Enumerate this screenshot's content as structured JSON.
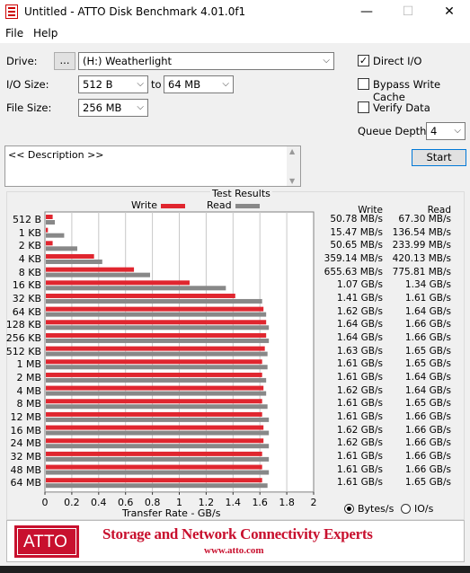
{
  "window": {
    "title": "Untitled - ATTO Disk Benchmark 4.01.0f1",
    "minimize": "—",
    "maximize": "☐",
    "close": "✕"
  },
  "menu": [
    "File",
    "Help"
  ],
  "form": {
    "drive_label": "Drive:",
    "browse_label": "...",
    "drive_value": "(H:) Weatherlight",
    "io_size_label": "I/O Size:",
    "io_from": "512 B",
    "to_label": "to",
    "io_to": "64 MB",
    "file_size_label": "File Size:",
    "file_size": "256 MB",
    "direct_io": "Direct I/O",
    "bypass_write_cache": "Bypass Write Cache",
    "verify_data": "Verify Data",
    "queue_depth_label": "Queue Depth:",
    "queue_depth": "4",
    "start_label": "Start",
    "description": "<< Description >>"
  },
  "results": {
    "title": "Test Results",
    "write_header": "Write",
    "read_header": "Read",
    "units": {
      "bytes": "Bytes/s",
      "io": "IO/s"
    }
  },
  "chart_data": {
    "type": "bar",
    "orientation": "horizontal",
    "title": "Test Results",
    "xlabel": "Transfer Rate - GB/s",
    "xlim": [
      0,
      2
    ],
    "xticks": [
      "0",
      "0.2",
      "0.4",
      "0.6",
      "0.8",
      "1",
      "1.2",
      "1.4",
      "1.6",
      "1.8",
      "2"
    ],
    "categories": [
      "512 B",
      "1 KB",
      "2 KB",
      "4 KB",
      "8 KB",
      "16 KB",
      "32 KB",
      "64 KB",
      "128 KB",
      "256 KB",
      "512 KB",
      "1 MB",
      "2 MB",
      "4 MB",
      "8 MB",
      "12 MB",
      "16 MB",
      "24 MB",
      "32 MB",
      "48 MB",
      "64 MB"
    ],
    "series": [
      {
        "name": "Write",
        "color": "#e0262f",
        "values": [
          0.0508,
          0.0155,
          0.0507,
          0.359,
          0.656,
          1.07,
          1.41,
          1.62,
          1.64,
          1.64,
          1.63,
          1.61,
          1.61,
          1.62,
          1.61,
          1.61,
          1.62,
          1.62,
          1.61,
          1.61,
          1.61
        ]
      },
      {
        "name": "Read",
        "color": "#888888",
        "values": [
          0.0673,
          0.1365,
          0.234,
          0.42,
          0.776,
          1.34,
          1.61,
          1.64,
          1.66,
          1.66,
          1.65,
          1.65,
          1.64,
          1.64,
          1.65,
          1.66,
          1.66,
          1.66,
          1.66,
          1.66,
          1.65
        ]
      }
    ],
    "write_text": [
      "50.78 MB/s",
      "15.47 MB/s",
      "50.65 MB/s",
      "359.14 MB/s",
      "655.63 MB/s",
      "1.07 GB/s",
      "1.41 GB/s",
      "1.62 GB/s",
      "1.64 GB/s",
      "1.64 GB/s",
      "1.63 GB/s",
      "1.61 GB/s",
      "1.61 GB/s",
      "1.62 GB/s",
      "1.61 GB/s",
      "1.61 GB/s",
      "1.62 GB/s",
      "1.62 GB/s",
      "1.61 GB/s",
      "1.61 GB/s",
      "1.61 GB/s"
    ],
    "read_text": [
      "67.30 MB/s",
      "136.54 MB/s",
      "233.99 MB/s",
      "420.13 MB/s",
      "775.81 MB/s",
      "1.34 GB/s",
      "1.61 GB/s",
      "1.64 GB/s",
      "1.66 GB/s",
      "1.66 GB/s",
      "1.65 GB/s",
      "1.65 GB/s",
      "1.64 GB/s",
      "1.64 GB/s",
      "1.65 GB/s",
      "1.66 GB/s",
      "1.66 GB/s",
      "1.66 GB/s",
      "1.66 GB/s",
      "1.66 GB/s",
      "1.65 GB/s"
    ]
  },
  "banner": {
    "logo": "ATTO",
    "tagline": "Storage and Network Connectivity Experts",
    "url": "www.atto.com"
  }
}
